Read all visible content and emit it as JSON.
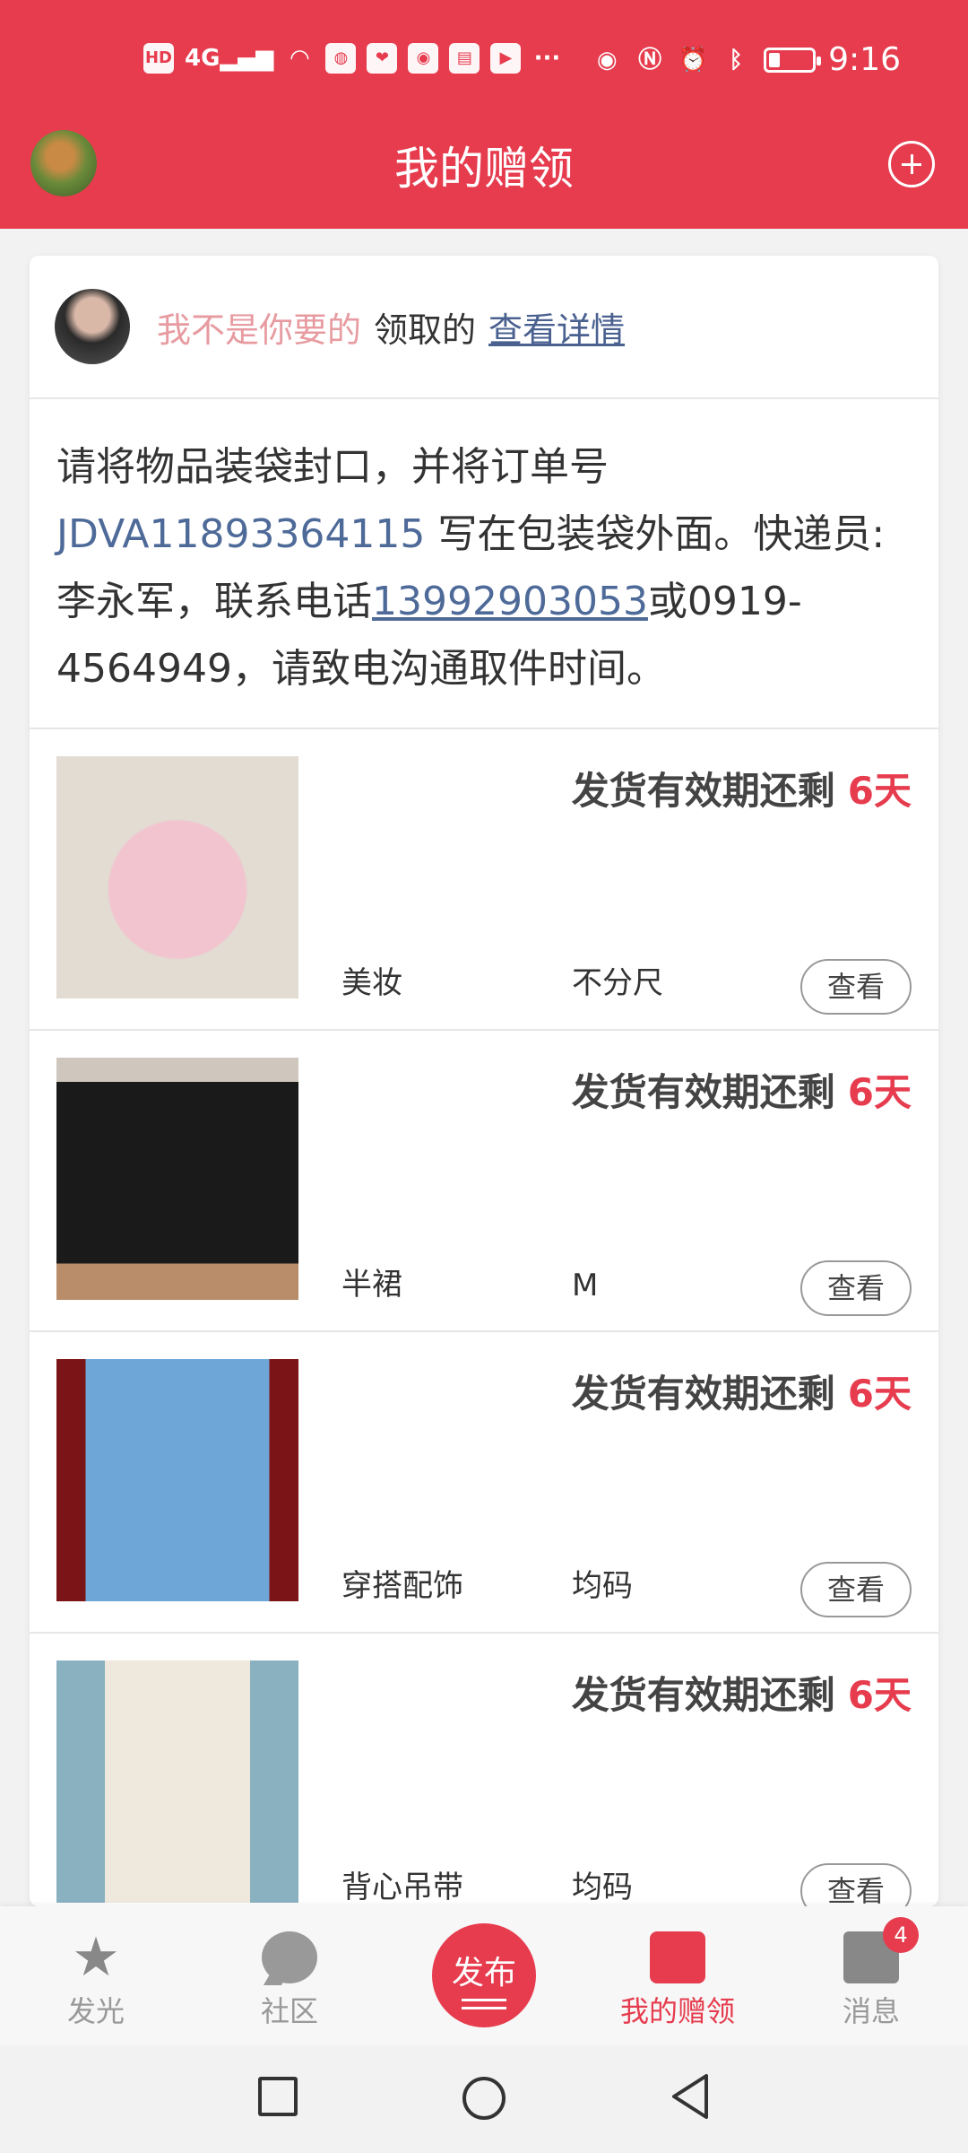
{
  "status_bar": {
    "time": "9:16",
    "network": "4G",
    "hd": "HD"
  },
  "header": {
    "title": "我的赠领"
  },
  "receiver": {
    "username": "我不是你要的",
    "action": "领取的",
    "detail_link": "查看详情"
  },
  "instructions": {
    "part1": "请将物品装袋封口，并将订单号 ",
    "order_number": "JDVA11893364115",
    "part2": " 写在包装袋外面。快递员:李永军，联系电话",
    "phone": "13992903053",
    "part3": "或0919-4564949，请致电沟通取件时间。"
  },
  "items": [
    {
      "deadline_label": "发货有效期还剩",
      "days": "6天",
      "category": "美妆",
      "size": "不分尺",
      "view": "查看",
      "thumb": "hand-cream"
    },
    {
      "deadline_label": "发货有效期还剩",
      "days": "6天",
      "category": "半裙",
      "size": "M",
      "view": "查看",
      "thumb": "black-skirt"
    },
    {
      "deadline_label": "发货有效期还剩",
      "days": "6天",
      "category": "穿搭配饰",
      "size": "均码",
      "view": "查看",
      "thumb": "blue-scarf"
    },
    {
      "deadline_label": "发货有效期还剩",
      "days": "6天",
      "category": "背心吊带",
      "size": "均码",
      "view": "查看",
      "thumb": "knit-vest"
    }
  ],
  "tabs": [
    {
      "label": "发光",
      "icon": "star-icon"
    },
    {
      "label": "社区",
      "icon": "chat-icon"
    },
    {
      "label": "我的赠领",
      "icon": "gift-icon",
      "active": true
    },
    {
      "label": "消息",
      "icon": "mail-icon",
      "badge": "4"
    }
  ],
  "publish": {
    "label": "发布"
  },
  "colors": {
    "brand": "#e63c4e",
    "link": "#4e6a98",
    "username": "#e79ba0"
  }
}
